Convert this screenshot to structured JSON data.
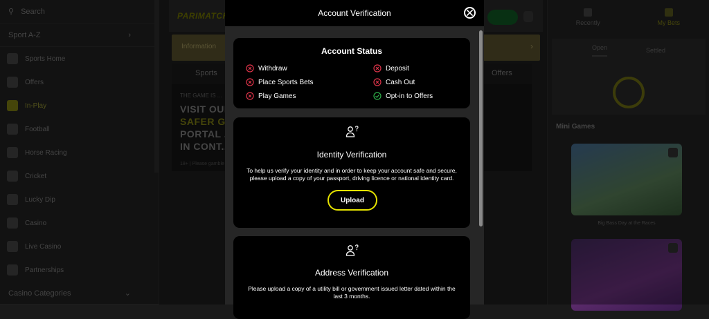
{
  "sidebar": {
    "search_label": "Search",
    "sport_az": "Sport A-Z",
    "items": [
      {
        "label": "Sports Home"
      },
      {
        "label": "Offers"
      },
      {
        "label": "In-Play"
      },
      {
        "label": "Football"
      },
      {
        "label": "Horse Racing"
      },
      {
        "label": "Cricket"
      },
      {
        "label": "Lucky Dip"
      },
      {
        "label": "Casino"
      },
      {
        "label": "Live Casino"
      },
      {
        "label": "Partnerships"
      }
    ],
    "casino_categories": "Casino Categories"
  },
  "center": {
    "brand": "PARIMATCH",
    "info_text": "Information",
    "tabs": {
      "sports": "Sports",
      "offers": "Offers"
    },
    "promo": {
      "small": "THE GAME IS ...",
      "lines": [
        "VISIT OUR",
        "SAFER G...",
        "PORTAL ...",
        "IN CONT..."
      ],
      "foot": "18+ | Please gamble responsibly"
    }
  },
  "right_panel": {
    "tabs": [
      {
        "label": "Recently"
      },
      {
        "label": "My Bets"
      }
    ],
    "bet_tabs": {
      "open": "Open",
      "settled": "Settled"
    },
    "mini_games_title": "Mini Games",
    "card1_caption": "Big Bass Day at the Races"
  },
  "modal": {
    "title": "Account Verification",
    "status": {
      "title": "Account Status",
      "items": [
        {
          "label": "Withdraw",
          "ok": false
        },
        {
          "label": "Deposit",
          "ok": false
        },
        {
          "label": "Place Sports Bets",
          "ok": false
        },
        {
          "label": "Cash Out",
          "ok": false
        },
        {
          "label": "Play Games",
          "ok": false
        },
        {
          "label": "Opt-in to Offers",
          "ok": true
        }
      ]
    },
    "identity": {
      "title": "Identity Verification",
      "description": "To help us verify your identity and in order to keep your account safe and secure, please upload a copy of your passport, driving licence or national identity card.",
      "upload_label": "Upload"
    },
    "address": {
      "title": "Address Verification",
      "description": "Please upload a copy of a utility bill or government issued letter dated within the last 3 months."
    }
  },
  "colors": {
    "accent_yellow": "#e6e400",
    "fail_red": "#e0344a",
    "ok_green": "#2fb24a"
  }
}
